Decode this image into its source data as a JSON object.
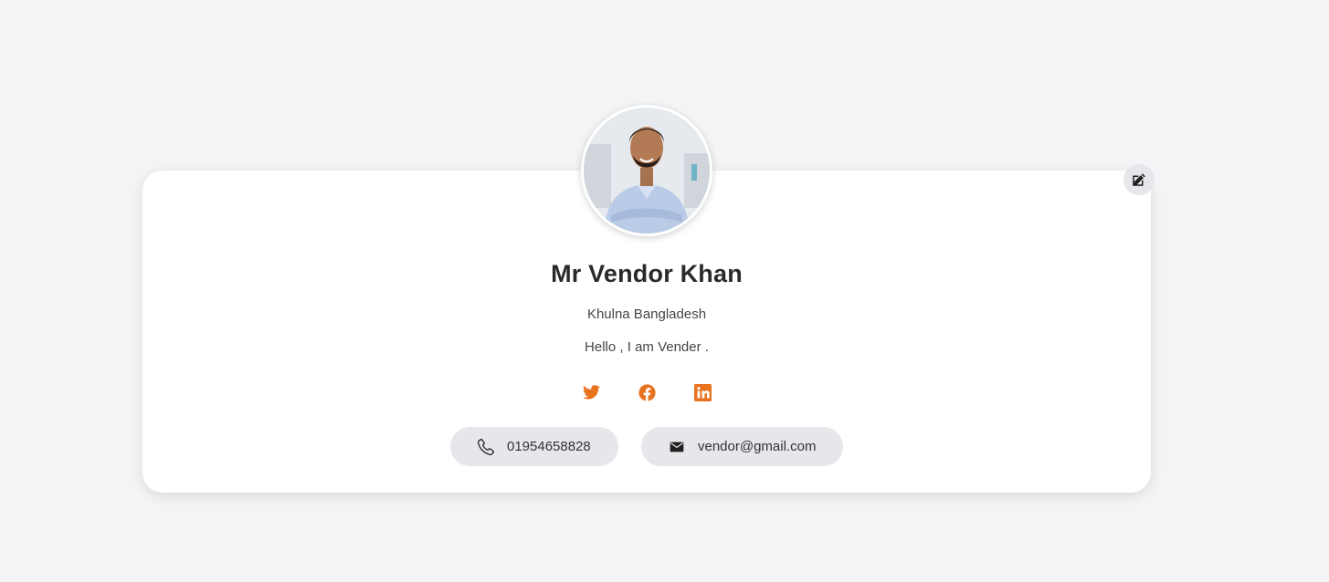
{
  "profile": {
    "name": "Mr Vendor Khan",
    "location": "Khulna Bangladesh",
    "bio": "Hello , I am Vender .",
    "phone": "01954658828",
    "email": "vendor@gmail.com"
  },
  "social": [
    {
      "name": "twitter-icon"
    },
    {
      "name": "facebook-icon"
    },
    {
      "name": "linkedin-icon"
    }
  ],
  "icons": {
    "edit": "edit-icon",
    "phone": "phone-icon",
    "email": "mail-icon"
  },
  "colors": {
    "accent": "#e8731f",
    "background": "#f3f4f6",
    "card": "#ffffff",
    "pill": "#e5e7eb",
    "text": "#2a2a2a"
  }
}
